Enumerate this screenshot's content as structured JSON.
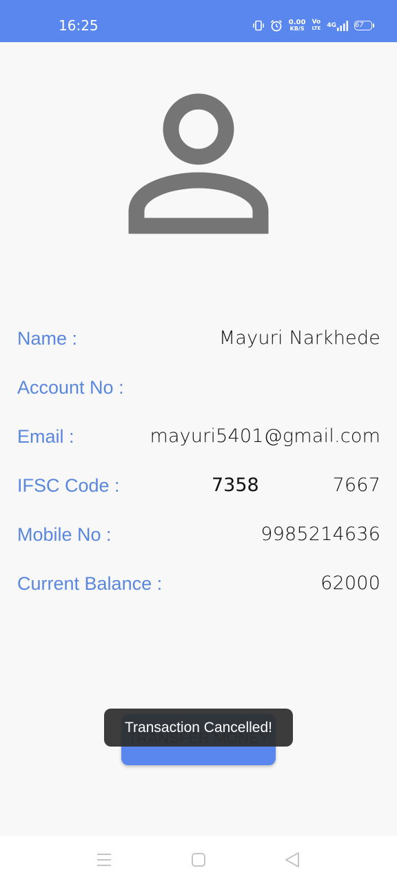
{
  "status_bar": {
    "time": "16:25",
    "net_speed": "0.00",
    "net_speed_unit": "KB/S",
    "volte_top": "Vo",
    "volte_bottom": "LTE",
    "network": "4G",
    "battery": "67",
    "colors": {
      "background": "#5a87ee"
    }
  },
  "profile": {
    "avatar_icon": "person-icon",
    "fields": [
      {
        "label": "Name :",
        "value": "Mayuri Narkhede"
      },
      {
        "label": "Account No :",
        "value": ""
      },
      {
        "label": "Email :",
        "value": "mayuri5401@gmail.com"
      },
      {
        "label": "IFSC Code :",
        "value_left": "7358",
        "value": "7667"
      },
      {
        "label": "Mobile No :",
        "value": "9985214636"
      },
      {
        "label": "Current Balance :",
        "value": "62000"
      }
    ]
  },
  "actions": {
    "transfer_label": "TRANSFER MONEY"
  },
  "toast": {
    "message": "Transaction Cancelled!"
  },
  "nav_bar": {
    "icons": [
      "menu-icon",
      "home-square-icon",
      "back-triangle-icon"
    ]
  },
  "colors": {
    "accent": "#5a87ee",
    "label": "#5a87de",
    "icon_gray": "#757575"
  }
}
